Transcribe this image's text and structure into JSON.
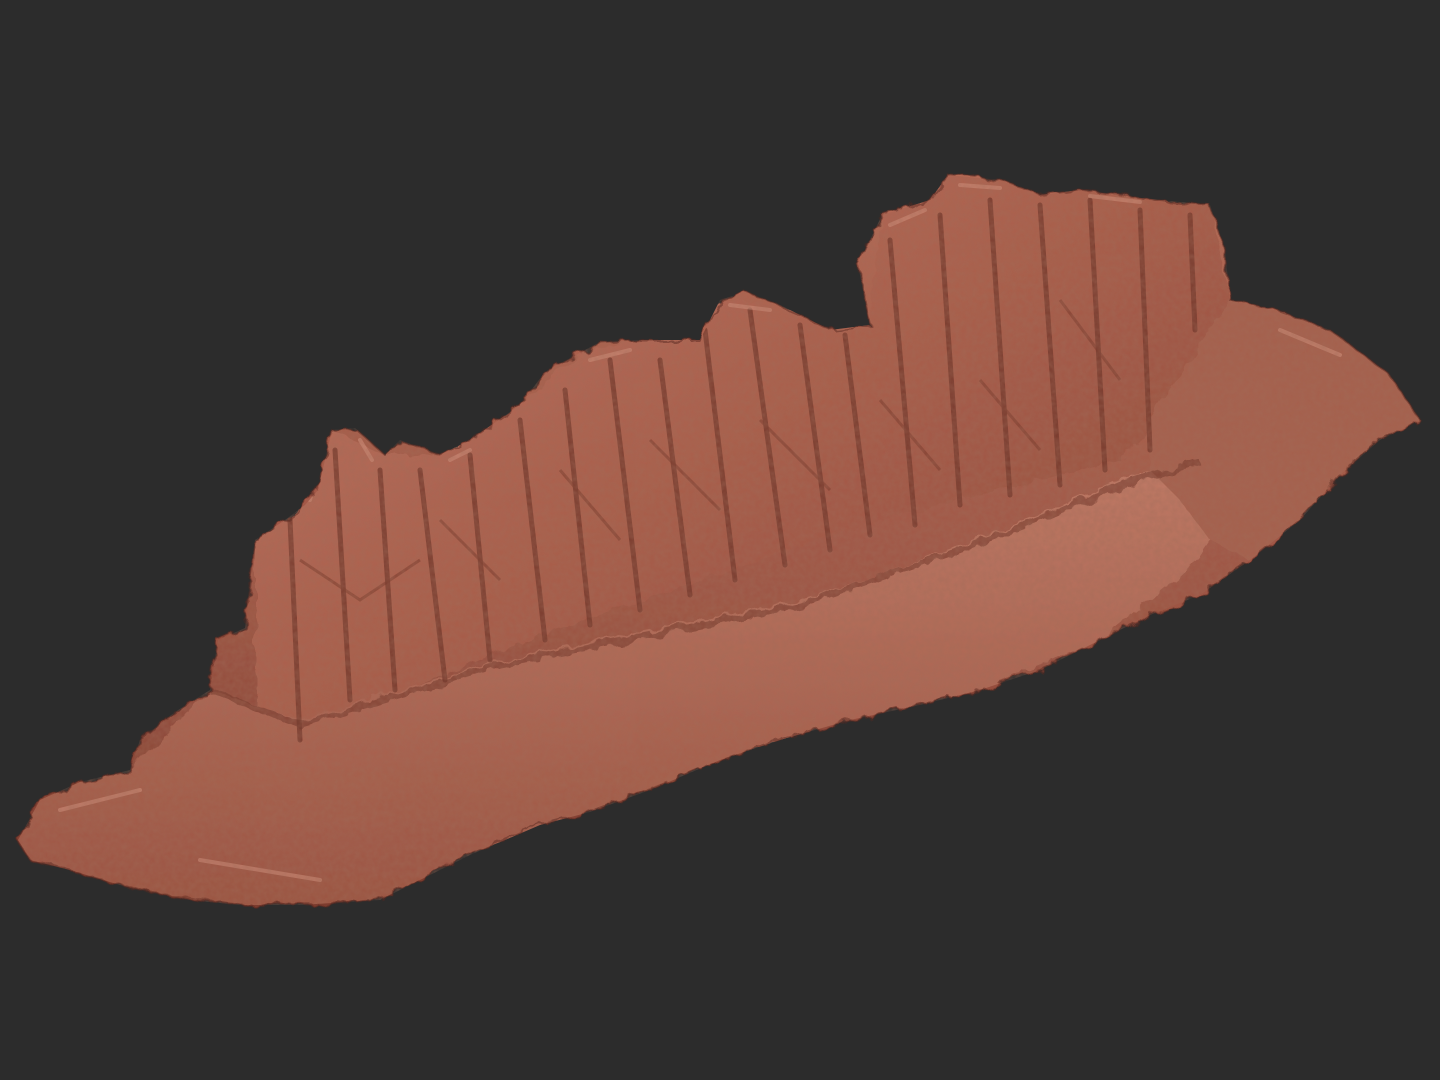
{
  "viewport": {
    "background_color": "#2c2c2c",
    "model": {
      "subject": "rock-cliff-sculpt",
      "material_color": "#b96a55",
      "shadow_color": "#6e3327",
      "highlight_color": "#d08a74"
    }
  }
}
